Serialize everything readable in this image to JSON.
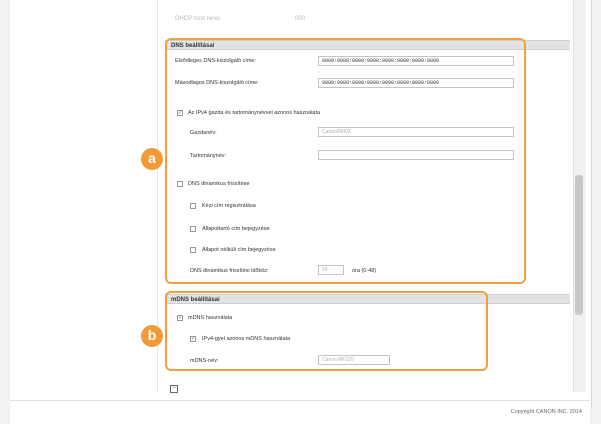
{
  "faded_row": {
    "label": "DHCP host neve:",
    "value": "000"
  },
  "dns": {
    "header": "DNS beállításai",
    "primary_label": "Elsődleges DNS-kiszolgáló címe:",
    "primary_value": "0000:0000:0000:0000:0000:0000:0000:0000",
    "secondary_label": "Másodlagos DNS-kiszolgáló címe:",
    "secondary_value": "0000:0000:0000:0000:0000:0000:0000:0000",
    "use_ipv4_label": "Az IPv4 gazda és tartománynévvel azonos használata",
    "use_ipv4_checked": "✓",
    "hostname_label": "Gazdanév:",
    "hostname_placeholder": "Canon0000X",
    "domain_label": "Tartománynév:",
    "domain_value": "",
    "dynamic_update_label": "DNS dinamikus frissítése",
    "manual_label": "Kézi cím regisztrálása",
    "stateful_label": "Állapottartó cím bejegyzése",
    "stateless_label": "Állapot nélküli cím bejegyzése",
    "interval_label": "DNS dinamikus frissítési időköz:",
    "interval_value": "24",
    "interval_unit": "óra (0-48)"
  },
  "mdns": {
    "header": "mDNS beállításai",
    "use_label": "mDNS használata",
    "use_checked": "✓",
    "same_label": "IPv4-gyel azonos mDNS használata",
    "same_checked": "✓",
    "name_label": "mDNS-név:",
    "name_placeholder": "Canon MF220"
  },
  "callouts": {
    "a": "a",
    "b": "b"
  },
  "footer": {
    "copyright": "Copyright CANON INC. 2014"
  },
  "colors": {
    "accent": "#f29a35",
    "header_bg": "#e3e3e3"
  }
}
